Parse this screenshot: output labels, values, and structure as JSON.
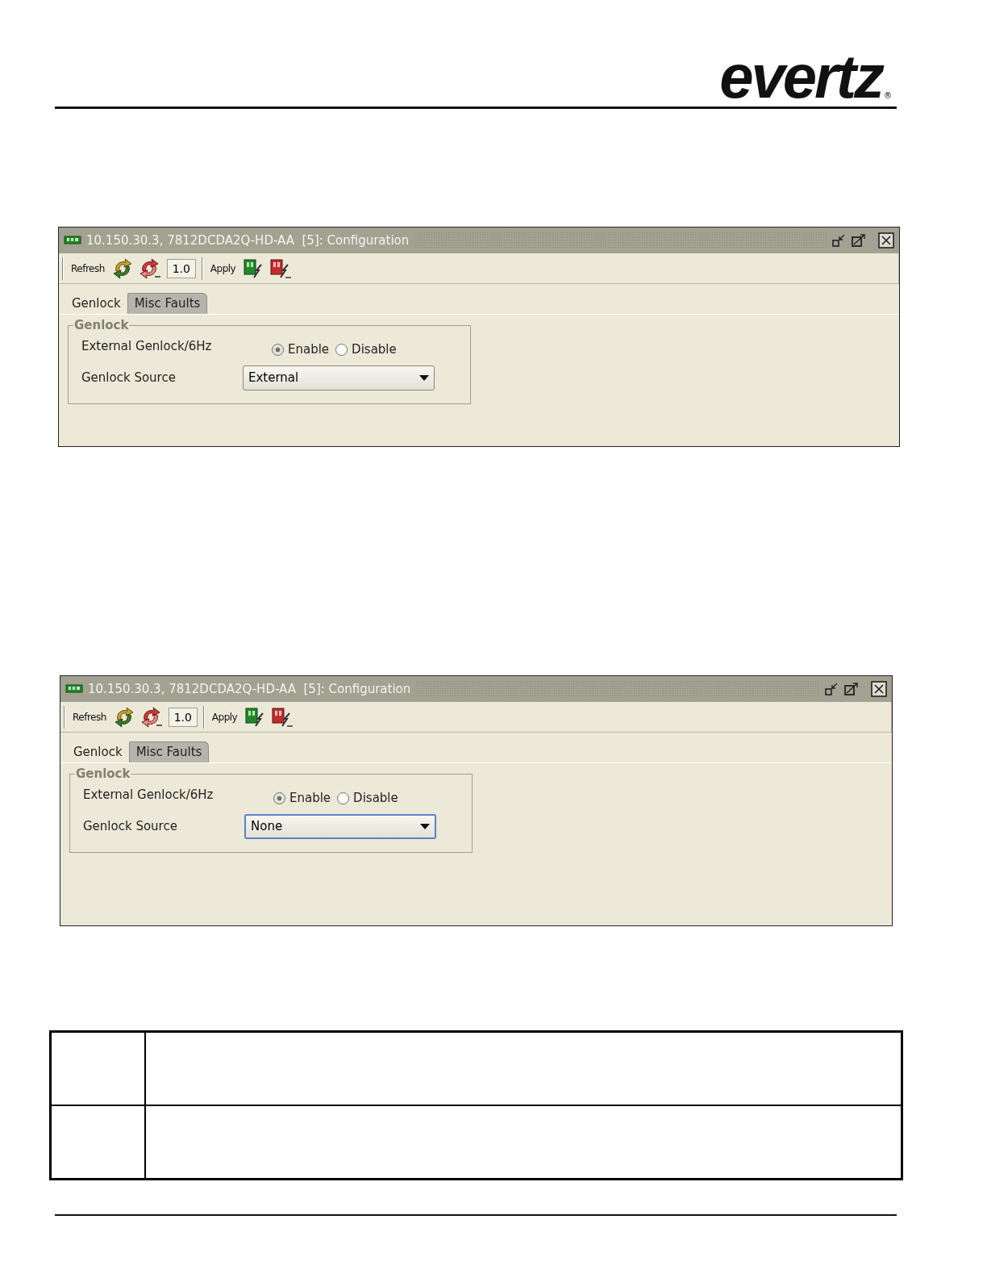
{
  "header": {
    "logo": "evertz",
    "registered": "®"
  },
  "windows": [
    {
      "title": "10.150.30.3, 7812DCDA2Q-HD-AA  [5]: Configuration",
      "toolbar": {
        "refresh": "Refresh",
        "version": "1.0",
        "apply": "Apply"
      },
      "tabs": [
        {
          "label": "Genlock",
          "selected": true
        },
        {
          "label": "Misc Faults",
          "selected": false
        }
      ],
      "group": {
        "title": "Genlock",
        "rows": [
          {
            "kind": "radio",
            "label": "External Genlock/6Hz",
            "options": [
              {
                "label": "Enable",
                "selected": true
              },
              {
                "label": "Disable",
                "selected": false
              }
            ]
          },
          {
            "kind": "dropdown",
            "label": "Genlock Source",
            "value": "External",
            "focused": false
          }
        ]
      }
    },
    {
      "title": "10.150.30.3, 7812DCDA2Q-HD-AA  [5]: Configuration",
      "toolbar": {
        "refresh": "Refresh",
        "version": "1.0",
        "apply": "Apply"
      },
      "tabs": [
        {
          "label": "Genlock",
          "selected": true
        },
        {
          "label": "Misc Faults",
          "selected": false
        }
      ],
      "group": {
        "title": "Genlock",
        "rows": [
          {
            "kind": "radio",
            "label": "External Genlock/6Hz",
            "options": [
              {
                "label": "Enable",
                "selected": true
              },
              {
                "label": "Disable",
                "selected": false
              }
            ]
          },
          {
            "kind": "dropdown",
            "label": "Genlock Source",
            "value": "None",
            "focused": true
          }
        ]
      }
    }
  ]
}
